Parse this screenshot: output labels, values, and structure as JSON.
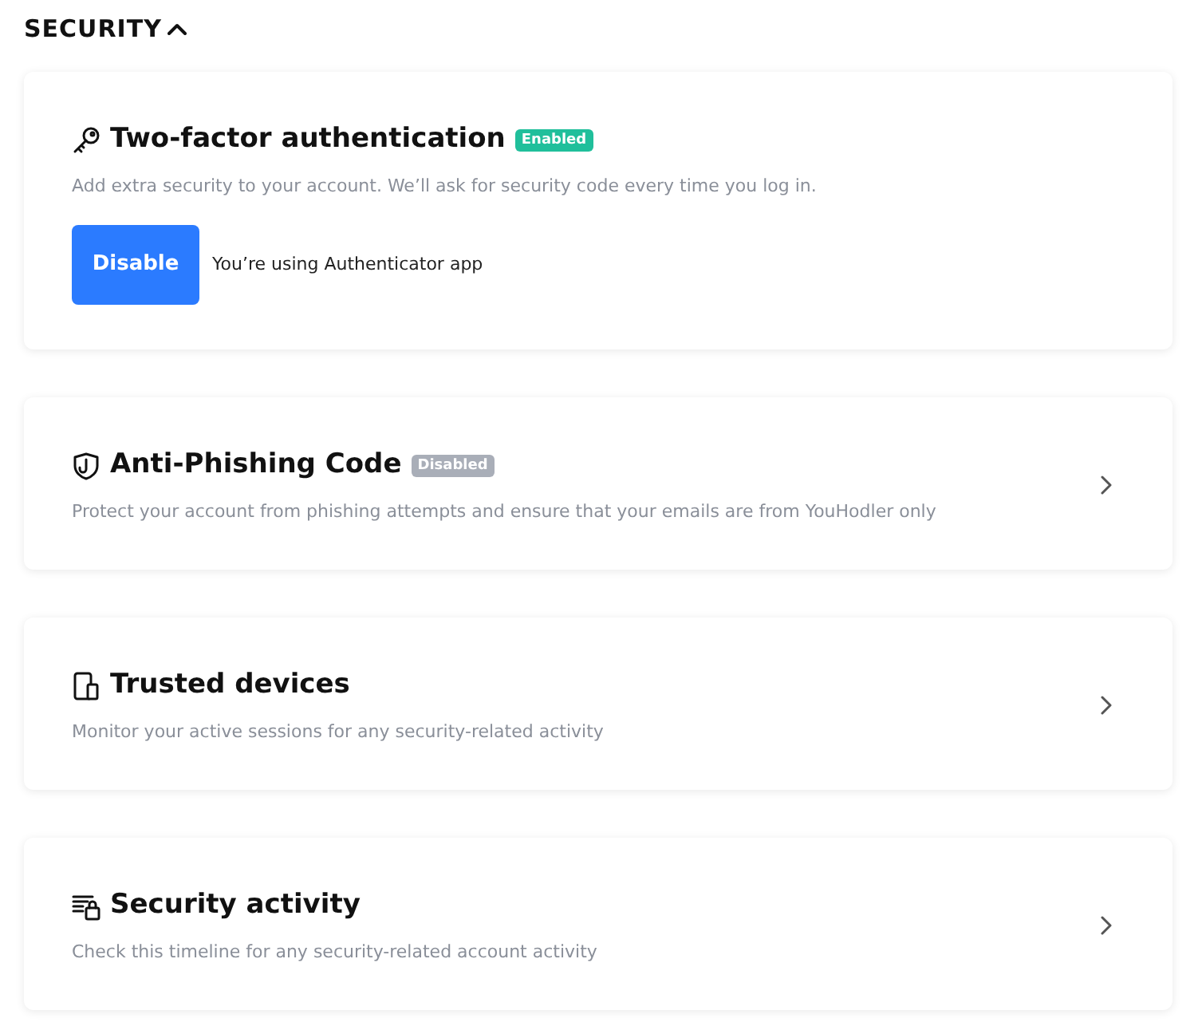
{
  "section": {
    "title": "SECURITY",
    "expanded": true
  },
  "cards": [
    {
      "kind": "action",
      "title": "Two-factor authentication",
      "badge": {
        "text": "Enabled",
        "on": true
      },
      "description": "Add extra security to your account. We’ll ask for security code every time you log in.",
      "button": "Disable",
      "note": "You’re using Authenticator app"
    },
    {
      "kind": "link",
      "title": "Anti-Phishing Code",
      "badge": {
        "text": "Disabled",
        "on": false
      },
      "description": "Protect your account from phishing attempts and ensure that your emails are from YouHodler only"
    },
    {
      "kind": "link",
      "title": "Trusted devices",
      "description": "Monitor your active sessions for any security-related activity"
    },
    {
      "kind": "link",
      "title": "Security activity",
      "description": "Check this timeline for any security-related account activity"
    }
  ]
}
